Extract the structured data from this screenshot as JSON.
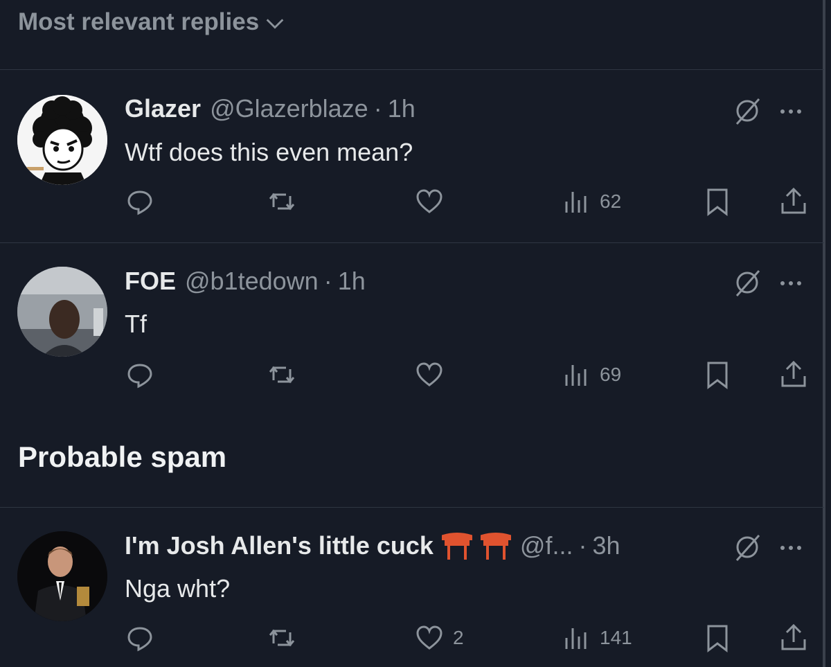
{
  "sort": {
    "label": "Most relevant replies"
  },
  "section": {
    "title": "Probable spam"
  },
  "replies": [
    {
      "display_name": "Glazer",
      "handle": "@Glazerblaze",
      "dot": "·",
      "time": "1h",
      "text": "Wtf does this even mean?",
      "views": "62",
      "likes": ""
    },
    {
      "display_name": "FOE",
      "handle": "@b1tedown",
      "dot": "·",
      "time": "1h",
      "text": "Tf",
      "views": "69",
      "likes": ""
    },
    {
      "display_name": "I'm Josh Allen's little cuck",
      "handle": "@f...",
      "dot": "·",
      "time": "3h",
      "text": "Nga wht?",
      "views": "141",
      "likes": "2"
    }
  ],
  "icons": {
    "reply": "reply-icon",
    "repost": "repost-icon",
    "like": "heart-icon",
    "views": "views-icon",
    "bookmark": "bookmark-icon",
    "share": "share-icon",
    "grok": "grok-icon",
    "more": "more-icon",
    "chevron": "chevron-down-icon",
    "emoji": "torii-gate-icon"
  },
  "colors": {
    "background": "#161b26",
    "text": "#e7e9ea",
    "muted": "#8d949c",
    "divider": "#2f3642",
    "torii": "#e0532f"
  }
}
